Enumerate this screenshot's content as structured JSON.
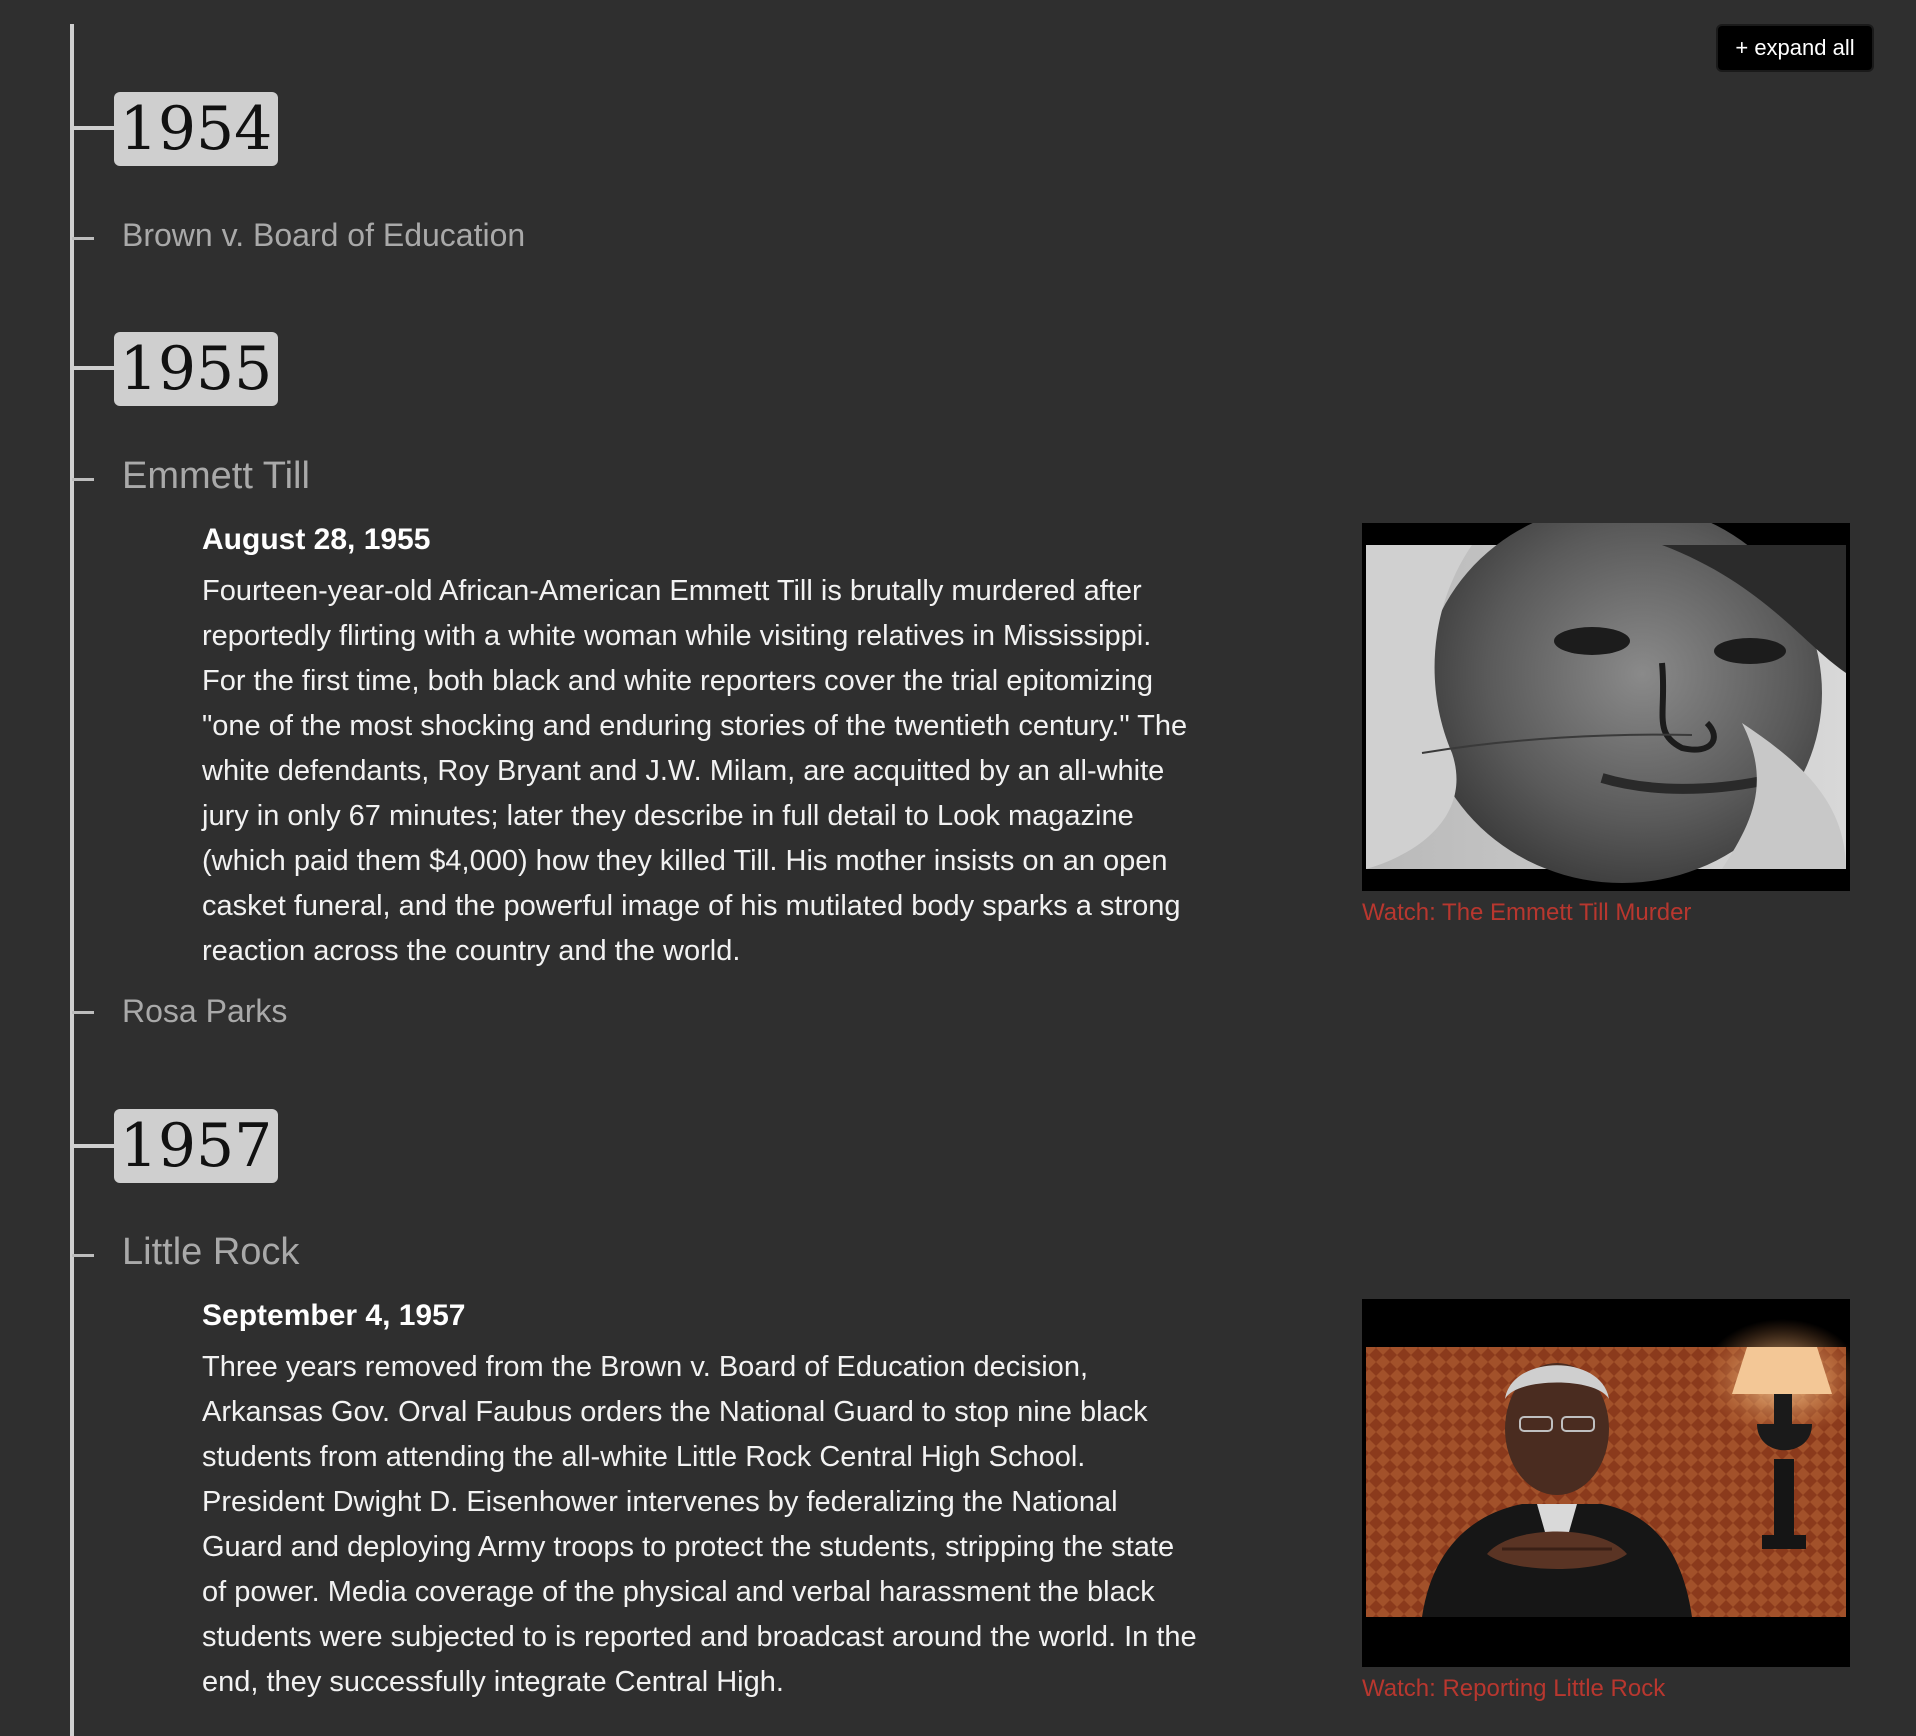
{
  "toolbar": {
    "expand_all_label": "+ expand all"
  },
  "timeline": {
    "years": [
      {
        "label": "1954"
      },
      {
        "label": "1955"
      },
      {
        "label": "1957"
      }
    ],
    "events": [
      {
        "title": "Brown v. Board of Education"
      },
      {
        "title": "Emmett Till",
        "date": "August 28, 1955",
        "body": "Fourteen-year-old African-American Emmett Till is brutally murdered after reportedly flirting with a white woman while visiting relatives in Mississippi. For the first time, both black and white reporters cover the trial epitomizing \"one of the most shocking and enduring stories of the twentieth century.\" The white defendants, Roy Bryant and J.W. Milam, are acquitted by an all-white jury in only 67 minutes; later they describe in full detail to Look magazine (which paid them $4,000) how they killed Till. His mother insists on an open casket funeral, and the powerful image of his mutilated body sparks a strong reaction across the country and the world.",
        "video_caption": "Watch: The Emmett Till Murder"
      },
      {
        "title": "Rosa Parks"
      },
      {
        "title": "Little Rock",
        "date": "September 4, 1957",
        "body": "Three years removed from the Brown v. Board of Education decision, Arkansas Gov. Orval Faubus orders the National Guard to stop nine black students from attending the all-white Little Rock Central High School. President Dwight D. Eisenhower intervenes by federalizing the National Guard and deploying Army troops to protect the students, stripping the state of power. Media coverage of the physical and verbal harassment the black students were subjected to is reported and broadcast around the world. In the end, they successfully integrate Central High.",
        "video_caption": "Watch: Reporting Little Rock"
      }
    ]
  },
  "colors": {
    "background": "#2f2f2f",
    "year_badge": "#cfcfcf",
    "link": "#b8372f",
    "event_title": "#a9a9a9"
  }
}
